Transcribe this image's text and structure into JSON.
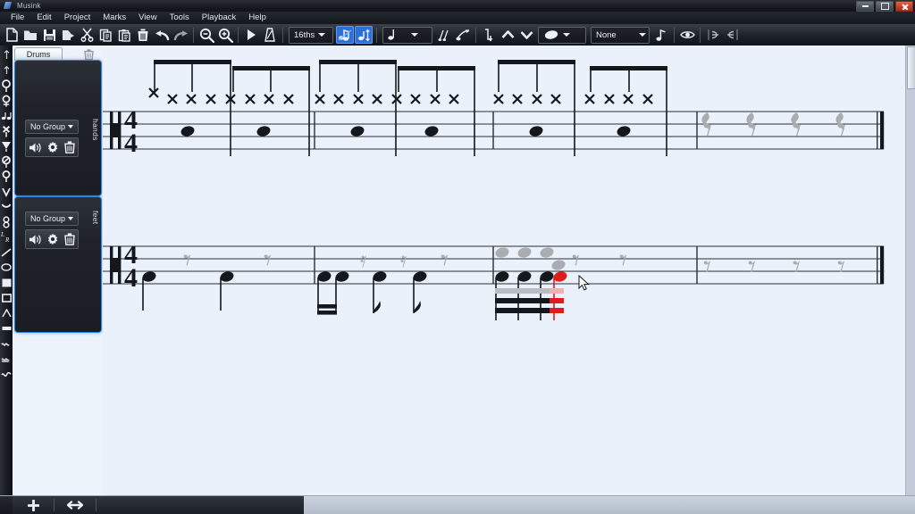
{
  "window": {
    "title": "Musink",
    "controls": {
      "minimize": "minimize",
      "maximize": "maximize",
      "close": "close"
    }
  },
  "menubar": {
    "items": [
      "File",
      "Edit",
      "Project",
      "Marks",
      "View",
      "Tools",
      "Playback",
      "Help"
    ]
  },
  "toolbar": {
    "buttons": [
      {
        "name": "new-file-icon",
        "title": "New"
      },
      {
        "name": "open-folder-icon",
        "title": "Open"
      },
      {
        "name": "save-icon",
        "title": "Save"
      },
      {
        "name": "export-icon",
        "title": "Export"
      },
      {
        "name": "cut-icon",
        "title": "Cut"
      },
      {
        "name": "copy-icon",
        "title": "Copy"
      },
      {
        "name": "paste-icon",
        "title": "Paste"
      },
      {
        "name": "delete-icon",
        "title": "Delete"
      },
      {
        "name": "undo-icon",
        "title": "Undo"
      },
      {
        "name": "redo-icon",
        "title": "Redo"
      },
      {
        "name": "zoom-out-icon",
        "title": "Zoom Out"
      },
      {
        "name": "zoom-in-icon",
        "title": "Zoom In"
      },
      {
        "name": "play-icon",
        "title": "Play"
      },
      {
        "name": "metronome-icon",
        "title": "Metronome"
      }
    ],
    "grid_value": "16ths",
    "toggle_snap_label": "snap-to-grid",
    "toggle_move_label": "move-vertical",
    "duration_value": "quarter-note",
    "grace_note_label": "grace-notes",
    "articulation_label": "articulation",
    "stem_down_label": "stem-down",
    "stem_up_label": "stem-up",
    "notehead_value": "oval-notehead",
    "dynamics_value": "None",
    "tuplet_label": "tuplet",
    "visibility_label": "visibility",
    "tie_start_label": "tie-start",
    "tie_end_label": "tie-end"
  },
  "palette": {
    "items": [
      "selection-icon",
      "arrow-up-icon",
      "notehead-circle-icon",
      "notehead-cross-circle-icon",
      "flam-icon",
      "notehead-x-icon",
      "notehead-triangle-down-icon",
      "notehead-slashed-circle-icon",
      "notehead-circle-stem-icon",
      "notehead-chevron-icon",
      "notehead-arc-icon",
      "notehead-chain-icon",
      "lr-sticking-icon",
      "diagonal-line-icon",
      "ellipse-icon",
      "filled-square-icon",
      "open-rect-icon",
      "tent-icon",
      "thick-bar-icon",
      "wave-1-icon",
      "wave-2-icon",
      "tilde-icon"
    ]
  },
  "tracks": {
    "tab_label": "Drums",
    "add_label": "add-track",
    "delete_label": "delete-track",
    "panels": [
      {
        "name": "hands",
        "vertical_label": "hands",
        "group_label": "No Group",
        "icons": [
          "speaker-icon",
          "gear-icon",
          "trash-icon"
        ]
      },
      {
        "name": "feet",
        "vertical_label": "feet",
        "group_label": "No Group",
        "icons": [
          "speaker-icon",
          "gear-icon",
          "trash-icon"
        ]
      }
    ]
  },
  "score": {
    "clef": "percussion-clef",
    "time_signature": {
      "numerator": "4",
      "denominator": "4"
    },
    "systems": [
      {
        "name": "hands-system",
        "measures": [
          {
            "index": 1,
            "hihat_count": 8,
            "bass_notes": 2
          },
          {
            "index": 2,
            "hihat_count": 8,
            "bass_notes": 2
          },
          {
            "index": 3,
            "hihat_count": 8,
            "bass_notes": 2
          },
          {
            "index": 4,
            "hihat_count": 0,
            "rests": 4
          }
        ]
      },
      {
        "name": "feet-system",
        "measures": [
          {
            "index": 1,
            "bass_notes": 2,
            "rests": 2
          },
          {
            "index": 2,
            "bass_notes": 4,
            "rests": 3
          },
          {
            "index": 3,
            "bass_notes": 4,
            "rests": 2,
            "selected_note": 4
          },
          {
            "index": 4,
            "rests": 4
          }
        ]
      }
    ],
    "colors": {
      "staff_line": "#2a2f36",
      "note": "#14181d",
      "ghost": "#a9acb0",
      "selected": "#e01b1b",
      "background": "#eaf1fb"
    }
  },
  "statusbar": {
    "buttons": [
      "add-system-icon",
      "resize-horizontal-icon"
    ]
  }
}
